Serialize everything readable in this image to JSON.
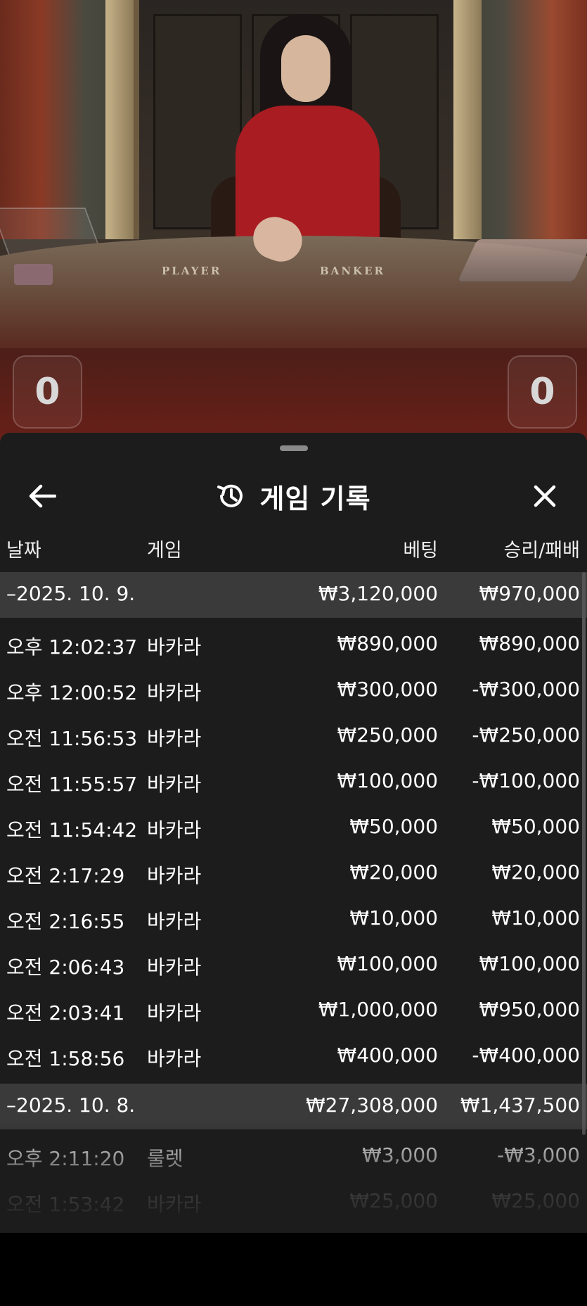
{
  "video": {
    "table_labels": {
      "player": "PLAYER",
      "banker": "BANKER"
    },
    "player_score": "0",
    "banker_score": "0"
  },
  "sheet": {
    "title": "게임 기록",
    "title_icon": "history-icon",
    "back_icon": "arrow-left-icon",
    "close_icon": "close-icon"
  },
  "columns": {
    "date": "날짜",
    "game": "게임",
    "bet": "베팅",
    "result": "승리/패배"
  },
  "groups": [
    {
      "date": "–2025. 10. 9.",
      "bet": "₩3,120,000",
      "result": "₩970,000",
      "rows": [
        {
          "time": "오후 12:02:37",
          "game": "바카라",
          "bet": "₩890,000",
          "result": "₩890,000"
        },
        {
          "time": "오후 12:00:52",
          "game": "바카라",
          "bet": "₩300,000",
          "result": "-₩300,000"
        },
        {
          "time": "오전 11:56:53",
          "game": "바카라",
          "bet": "₩250,000",
          "result": "-₩250,000"
        },
        {
          "time": "오전 11:55:57",
          "game": "바카라",
          "bet": "₩100,000",
          "result": "-₩100,000"
        },
        {
          "time": "오전 11:54:42",
          "game": "바카라",
          "bet": "₩50,000",
          "result": "₩50,000"
        },
        {
          "time": "오전 2:17:29",
          "game": "바카라",
          "bet": "₩20,000",
          "result": "₩20,000"
        },
        {
          "time": "오전 2:16:55",
          "game": "바카라",
          "bet": "₩10,000",
          "result": "₩10,000"
        },
        {
          "time": "오전 2:06:43",
          "game": "바카라",
          "bet": "₩100,000",
          "result": "₩100,000"
        },
        {
          "time": "오전 2:03:41",
          "game": "바카라",
          "bet": "₩1,000,000",
          "result": "₩950,000"
        },
        {
          "time": "오전 1:58:56",
          "game": "바카라",
          "bet": "₩400,000",
          "result": "-₩400,000"
        }
      ]
    },
    {
      "date": "–2025. 10. 8.",
      "bet": "₩27,308,000",
      "result": "₩1,437,500",
      "rows": [
        {
          "time": "오후 2:11:20",
          "game": "룰렛",
          "bet": "₩3,000",
          "result": "-₩3,000"
        },
        {
          "time": "오전 1:53:42",
          "game": "바카라",
          "bet": "₩25,000",
          "result": "₩25,000"
        }
      ]
    }
  ]
}
